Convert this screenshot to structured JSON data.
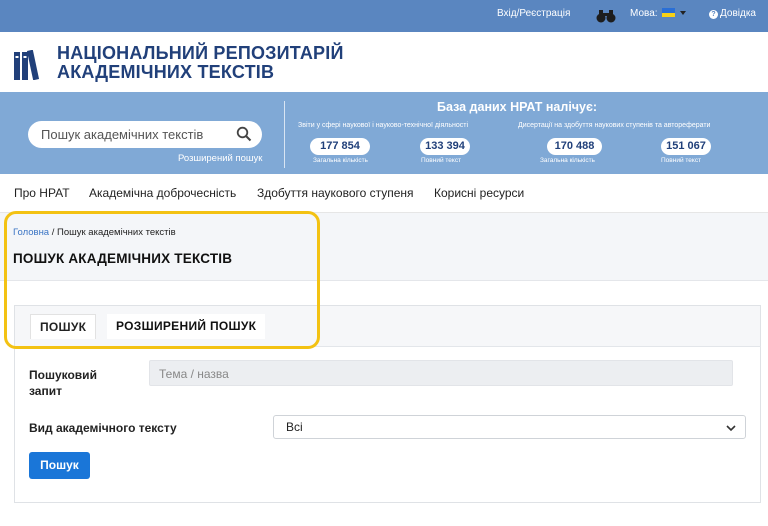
{
  "topbar": {
    "login": "Вхід/Реєстрація",
    "binoculars_icon": "binoculars-icon",
    "language_label": "Мова:",
    "help": "Довідка"
  },
  "logo": {
    "line1": "НАЦІОНАЛЬНИЙ РЕПОЗИТАРІЙ",
    "line2": "АКАДЕМІЧНИХ ТЕКСТІВ",
    "icon": "books-icon"
  },
  "banner": {
    "search_placeholder": "Пошук академічних текстів",
    "advanced_link": "Розширений пошук",
    "db_title": "База даних НРАТ налічує:",
    "cat_reports": "Звіти у сфері наукової і науково-технічної діяльності",
    "cat_dissertations": "Дисертації на здобуття наукових ступенів та автореферати",
    "stats": [
      {
        "value": "177 854",
        "label": "Загальна кількість"
      },
      {
        "value": "133 394",
        "label": "Повний текст"
      },
      {
        "value": "170 488",
        "label": "Загальна кількість"
      },
      {
        "value": "151 067",
        "label": "Повний текст"
      }
    ]
  },
  "nav": {
    "items": [
      "Про НРАТ",
      "Академічна доброчесність",
      "Здобуття наукового ступеня",
      "Корисні ресурси"
    ]
  },
  "breadcrumb": {
    "home": "Головна",
    "separator": " / ",
    "current": "Пошук академічних текстів"
  },
  "page_title": "ПОШУК АКАДЕМІЧНИХ ТЕКСТІВ",
  "tabs": [
    {
      "label": "ПОШУК",
      "active": true
    },
    {
      "label": "РОЗШИРЕНИЙ ПОШУК",
      "active": false
    }
  ],
  "form": {
    "query_label_1": "Пошуковий",
    "query_label_2": "запит",
    "query_placeholder": "Тема / назва",
    "type_label": "Вид академічного тексту",
    "type_value": "Всі",
    "submit": "Пошук"
  },
  "colors": {
    "topbar": "#5a86c0",
    "banner": "#80a9d6",
    "brand_text": "#21407a",
    "button": "#1a76d8",
    "highlight": "#f3c213"
  }
}
